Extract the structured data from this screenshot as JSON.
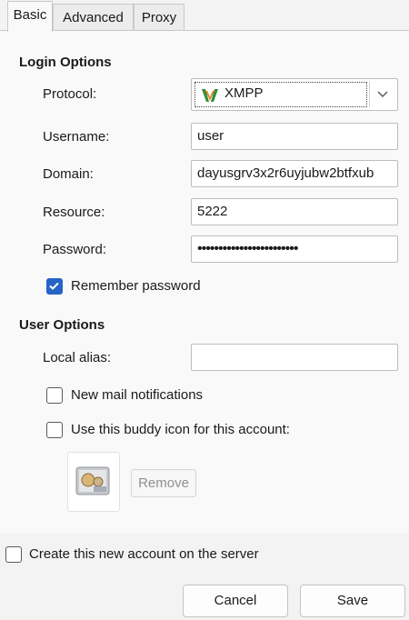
{
  "tabs": [
    {
      "label": "Basic"
    },
    {
      "label": "Advanced"
    },
    {
      "label": "Proxy"
    }
  ],
  "login_options": {
    "title": "Login Options",
    "protocol": {
      "label": "Protocol:",
      "value": "XMPP",
      "icon": "xmpp-icon"
    },
    "username": {
      "label": "Username:",
      "value": "user"
    },
    "domain": {
      "label": "Domain:",
      "value": "dayusgrv3x2r6uyjubw2btfxub"
    },
    "resource": {
      "label": "Resource:",
      "value": "5222"
    },
    "password": {
      "label": "Password:",
      "value": "••••••••••••••••••••••••"
    },
    "remember_password": {
      "label": "Remember password",
      "checked": true
    }
  },
  "user_options": {
    "title": "User Options",
    "local_alias": {
      "label": "Local alias:",
      "value": ""
    },
    "new_mail": {
      "label": "New mail notifications",
      "checked": false
    },
    "buddy_icon": {
      "label": "Use this buddy icon for this account:",
      "checked": false
    },
    "remove_label": "Remove"
  },
  "create_account": {
    "label": "Create this new account on the server",
    "checked": false
  },
  "buttons": {
    "cancel": "Cancel",
    "save": "Save"
  },
  "colors": {
    "accent": "#2563c7",
    "background": "#f3f3f3",
    "panel": "#f9f9f9"
  }
}
